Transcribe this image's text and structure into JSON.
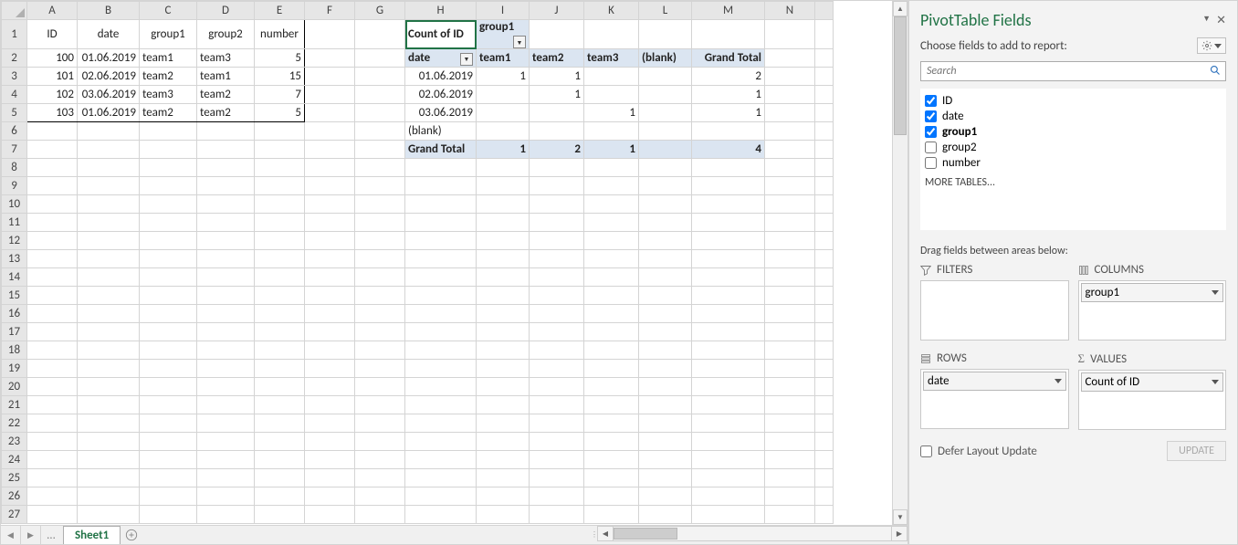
{
  "columns": [
    "A",
    "B",
    "C",
    "D",
    "E",
    "F",
    "G",
    "H",
    "I",
    "J",
    "K",
    "L",
    "M",
    "N"
  ],
  "source": {
    "headers": {
      "A": "ID",
      "B": "date",
      "C": "group1",
      "D": "group2",
      "E": "number"
    },
    "rows": [
      {
        "A": "100",
        "B": "01.06.2019",
        "C": "team1",
        "D": "team3",
        "E": "5"
      },
      {
        "A": "101",
        "B": "02.06.2019",
        "C": "team2",
        "D": "team1",
        "E": "15"
      },
      {
        "A": "102",
        "B": "03.06.2019",
        "C": "team3",
        "D": "team2",
        "E": "7"
      },
      {
        "A": "103",
        "B": "01.06.2019",
        "C": "team2",
        "D": "team2",
        "E": "5"
      }
    ]
  },
  "pivot": {
    "count_label": "Count of ID",
    "col_field": "group1",
    "row_field": "date",
    "col_headers": [
      "team1",
      "team2",
      "team3",
      "(blank)",
      "Grand Total"
    ],
    "rows": [
      {
        "label": "01.06.2019",
        "vals": [
          "1",
          "1",
          "",
          "",
          "2"
        ]
      },
      {
        "label": "02.06.2019",
        "vals": [
          "",
          "1",
          "",
          "",
          "1"
        ]
      },
      {
        "label": "03.06.2019",
        "vals": [
          "",
          "",
          "1",
          "",
          "1"
        ]
      },
      {
        "label": "(blank)",
        "vals": [
          "",
          "",
          "",
          "",
          ""
        ]
      }
    ],
    "grand_label": "Grand Total",
    "grand_vals": [
      "1",
      "2",
      "1",
      "",
      "4"
    ]
  },
  "panel": {
    "title": "PivotTable Fields",
    "subtitle": "Choose fields to add to report:",
    "search_placeholder": "Search",
    "fields": [
      {
        "name": "ID",
        "checked": true,
        "bold": false
      },
      {
        "name": "date",
        "checked": true,
        "bold": false
      },
      {
        "name": "group1",
        "checked": true,
        "bold": true
      },
      {
        "name": "group2",
        "checked": false,
        "bold": false
      },
      {
        "name": "number",
        "checked": false,
        "bold": false
      }
    ],
    "more": "MORE TABLES...",
    "drag": "Drag fields between areas below:",
    "filters": "FILTERS",
    "columns_lbl": "COLUMNS",
    "rows_lbl": "ROWS",
    "values_lbl": "VALUES",
    "col_field": "group1",
    "row_field": "date",
    "val_field": "Count of ID",
    "defer": "Defer Layout Update",
    "update": "UPDATE"
  },
  "tab": "Sheet1"
}
